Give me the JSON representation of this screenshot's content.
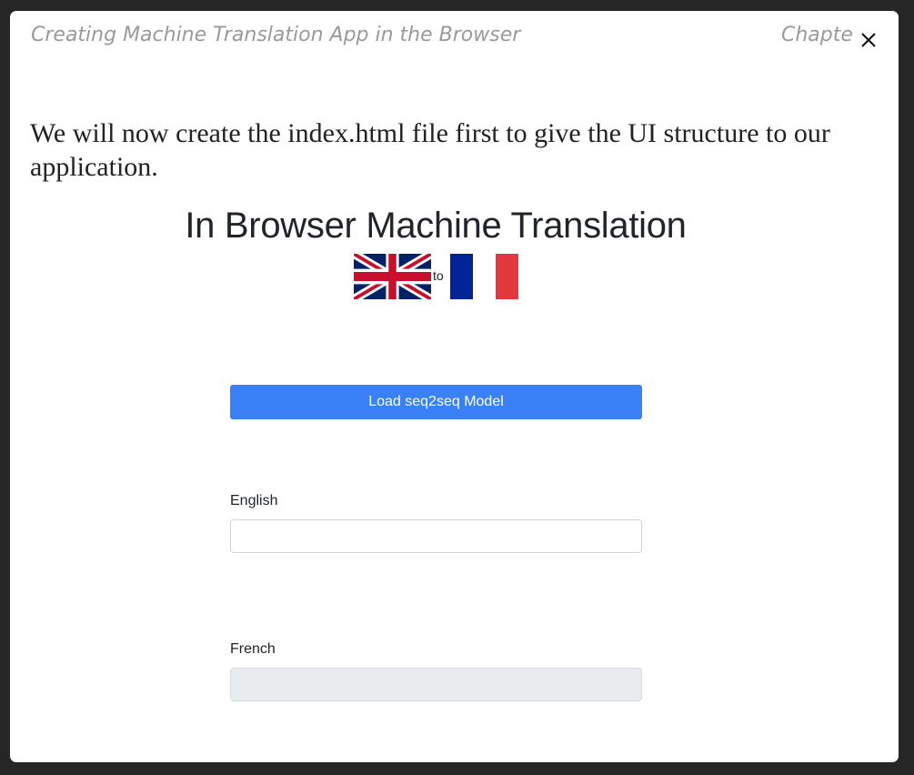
{
  "modal": {
    "book_title": "Creating Machine Translation App in the Browser",
    "chapter_label": "Chapter",
    "close_icon": "close-icon"
  },
  "content": {
    "intro_text": "We will now create the index.html file first to give the UI structure to our application."
  },
  "app": {
    "title": "In Browser Machine Translation",
    "source_flag": "uk-flag-icon",
    "connector": "to",
    "target_flag": "france-flag-icon",
    "load_button_label": "Load seq2seq Model",
    "english_label": "English",
    "english_value": "",
    "french_label": "French",
    "french_value": ""
  },
  "colors": {
    "primary_button": "#3a80f6",
    "disabled_input": "#e9ecef",
    "header_text": "#9a9a9a"
  }
}
